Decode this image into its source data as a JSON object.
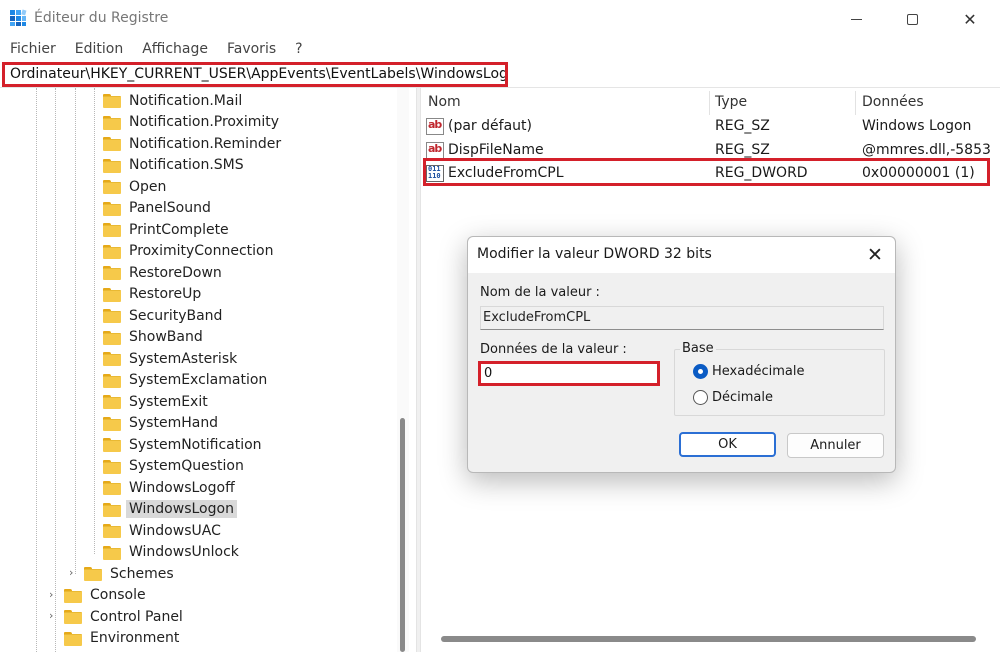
{
  "window": {
    "title": "Éditeur du Registre"
  },
  "menu": [
    "Fichier",
    "Edition",
    "Affichage",
    "Favoris",
    "?"
  ],
  "address": {
    "path": "Ordinateur\\HKEY_CURRENT_USER\\AppEvents\\EventLabels\\WindowsLogon"
  },
  "tree": {
    "children_level": [
      {
        "label": "Notification.Mail"
      },
      {
        "label": "Notification.Proximity"
      },
      {
        "label": "Notification.Reminder"
      },
      {
        "label": "Notification.SMS"
      },
      {
        "label": "Open"
      },
      {
        "label": "PanelSound"
      },
      {
        "label": "PrintComplete"
      },
      {
        "label": "ProximityConnection"
      },
      {
        "label": "RestoreDown"
      },
      {
        "label": "RestoreUp"
      },
      {
        "label": "SecurityBand"
      },
      {
        "label": "ShowBand"
      },
      {
        "label": "SystemAsterisk"
      },
      {
        "label": "SystemExclamation"
      },
      {
        "label": "SystemExit"
      },
      {
        "label": "SystemHand"
      },
      {
        "label": "SystemNotification"
      },
      {
        "label": "SystemQuestion"
      },
      {
        "label": "WindowsLogoff"
      },
      {
        "label": "WindowsLogon",
        "selected": true
      },
      {
        "label": "WindowsUAC"
      },
      {
        "label": "WindowsUnlock"
      }
    ],
    "schemes": "Schemes",
    "top_level": [
      "Console",
      "Control Panel",
      "Environment"
    ]
  },
  "list": {
    "columns": [
      "Nom",
      "Type",
      "Données"
    ],
    "rows": [
      {
        "icon": "string-value-icon",
        "name": "(par défaut)",
        "type": "REG_SZ",
        "data": "Windows Logon"
      },
      {
        "icon": "string-value-icon",
        "name": "DispFileName",
        "type": "REG_SZ",
        "data": "@mmres.dll,-5853"
      },
      {
        "icon": "binary-value-icon",
        "name": "ExcludeFromCPL",
        "type": "REG_DWORD",
        "data": "0x00000001 (1)"
      }
    ]
  },
  "dialog": {
    "title": "Modifier la valeur DWORD 32 bits",
    "value_name_label": "Nom de la valeur :",
    "value_name": "ExcludeFromCPL",
    "value_data_label": "Données de la valeur :",
    "value_data": "0",
    "base_label": "Base",
    "radio_hex": "Hexadécimale",
    "radio_dec": "Décimale",
    "selected_base": "hex",
    "ok_label": "OK",
    "cancel_label": "Annuler"
  },
  "colors": {
    "highlight": "#d4202a",
    "accent": "#0a5bc4",
    "folder": "#f6c94a"
  }
}
